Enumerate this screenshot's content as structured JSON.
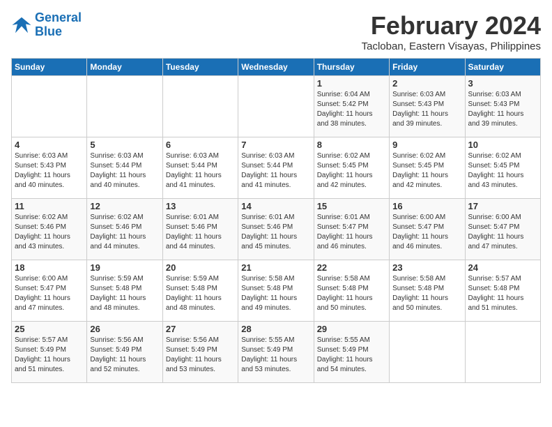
{
  "header": {
    "logo_line1": "General",
    "logo_line2": "Blue",
    "month_title": "February 2024",
    "subtitle": "Tacloban, Eastern Visayas, Philippines"
  },
  "days_of_week": [
    "Sunday",
    "Monday",
    "Tuesday",
    "Wednesday",
    "Thursday",
    "Friday",
    "Saturday"
  ],
  "weeks": [
    [
      {
        "day": "",
        "info": ""
      },
      {
        "day": "",
        "info": ""
      },
      {
        "day": "",
        "info": ""
      },
      {
        "day": "",
        "info": ""
      },
      {
        "day": "1",
        "info": "Sunrise: 6:04 AM\nSunset: 5:42 PM\nDaylight: 11 hours\nand 38 minutes."
      },
      {
        "day": "2",
        "info": "Sunrise: 6:03 AM\nSunset: 5:43 PM\nDaylight: 11 hours\nand 39 minutes."
      },
      {
        "day": "3",
        "info": "Sunrise: 6:03 AM\nSunset: 5:43 PM\nDaylight: 11 hours\nand 39 minutes."
      }
    ],
    [
      {
        "day": "4",
        "info": "Sunrise: 6:03 AM\nSunset: 5:43 PM\nDaylight: 11 hours\nand 40 minutes."
      },
      {
        "day": "5",
        "info": "Sunrise: 6:03 AM\nSunset: 5:44 PM\nDaylight: 11 hours\nand 40 minutes."
      },
      {
        "day": "6",
        "info": "Sunrise: 6:03 AM\nSunset: 5:44 PM\nDaylight: 11 hours\nand 41 minutes."
      },
      {
        "day": "7",
        "info": "Sunrise: 6:03 AM\nSunset: 5:44 PM\nDaylight: 11 hours\nand 41 minutes."
      },
      {
        "day": "8",
        "info": "Sunrise: 6:02 AM\nSunset: 5:45 PM\nDaylight: 11 hours\nand 42 minutes."
      },
      {
        "day": "9",
        "info": "Sunrise: 6:02 AM\nSunset: 5:45 PM\nDaylight: 11 hours\nand 42 minutes."
      },
      {
        "day": "10",
        "info": "Sunrise: 6:02 AM\nSunset: 5:45 PM\nDaylight: 11 hours\nand 43 minutes."
      }
    ],
    [
      {
        "day": "11",
        "info": "Sunrise: 6:02 AM\nSunset: 5:46 PM\nDaylight: 11 hours\nand 43 minutes."
      },
      {
        "day": "12",
        "info": "Sunrise: 6:02 AM\nSunset: 5:46 PM\nDaylight: 11 hours\nand 44 minutes."
      },
      {
        "day": "13",
        "info": "Sunrise: 6:01 AM\nSunset: 5:46 PM\nDaylight: 11 hours\nand 44 minutes."
      },
      {
        "day": "14",
        "info": "Sunrise: 6:01 AM\nSunset: 5:46 PM\nDaylight: 11 hours\nand 45 minutes."
      },
      {
        "day": "15",
        "info": "Sunrise: 6:01 AM\nSunset: 5:47 PM\nDaylight: 11 hours\nand 46 minutes."
      },
      {
        "day": "16",
        "info": "Sunrise: 6:00 AM\nSunset: 5:47 PM\nDaylight: 11 hours\nand 46 minutes."
      },
      {
        "day": "17",
        "info": "Sunrise: 6:00 AM\nSunset: 5:47 PM\nDaylight: 11 hours\nand 47 minutes."
      }
    ],
    [
      {
        "day": "18",
        "info": "Sunrise: 6:00 AM\nSunset: 5:47 PM\nDaylight: 11 hours\nand 47 minutes."
      },
      {
        "day": "19",
        "info": "Sunrise: 5:59 AM\nSunset: 5:48 PM\nDaylight: 11 hours\nand 48 minutes."
      },
      {
        "day": "20",
        "info": "Sunrise: 5:59 AM\nSunset: 5:48 PM\nDaylight: 11 hours\nand 48 minutes."
      },
      {
        "day": "21",
        "info": "Sunrise: 5:58 AM\nSunset: 5:48 PM\nDaylight: 11 hours\nand 49 minutes."
      },
      {
        "day": "22",
        "info": "Sunrise: 5:58 AM\nSunset: 5:48 PM\nDaylight: 11 hours\nand 50 minutes."
      },
      {
        "day": "23",
        "info": "Sunrise: 5:58 AM\nSunset: 5:48 PM\nDaylight: 11 hours\nand 50 minutes."
      },
      {
        "day": "24",
        "info": "Sunrise: 5:57 AM\nSunset: 5:48 PM\nDaylight: 11 hours\nand 51 minutes."
      }
    ],
    [
      {
        "day": "25",
        "info": "Sunrise: 5:57 AM\nSunset: 5:49 PM\nDaylight: 11 hours\nand 51 minutes."
      },
      {
        "day": "26",
        "info": "Sunrise: 5:56 AM\nSunset: 5:49 PM\nDaylight: 11 hours\nand 52 minutes."
      },
      {
        "day": "27",
        "info": "Sunrise: 5:56 AM\nSunset: 5:49 PM\nDaylight: 11 hours\nand 53 minutes."
      },
      {
        "day": "28",
        "info": "Sunrise: 5:55 AM\nSunset: 5:49 PM\nDaylight: 11 hours\nand 53 minutes."
      },
      {
        "day": "29",
        "info": "Sunrise: 5:55 AM\nSunset: 5:49 PM\nDaylight: 11 hours\nand 54 minutes."
      },
      {
        "day": "",
        "info": ""
      },
      {
        "day": "",
        "info": ""
      }
    ]
  ]
}
